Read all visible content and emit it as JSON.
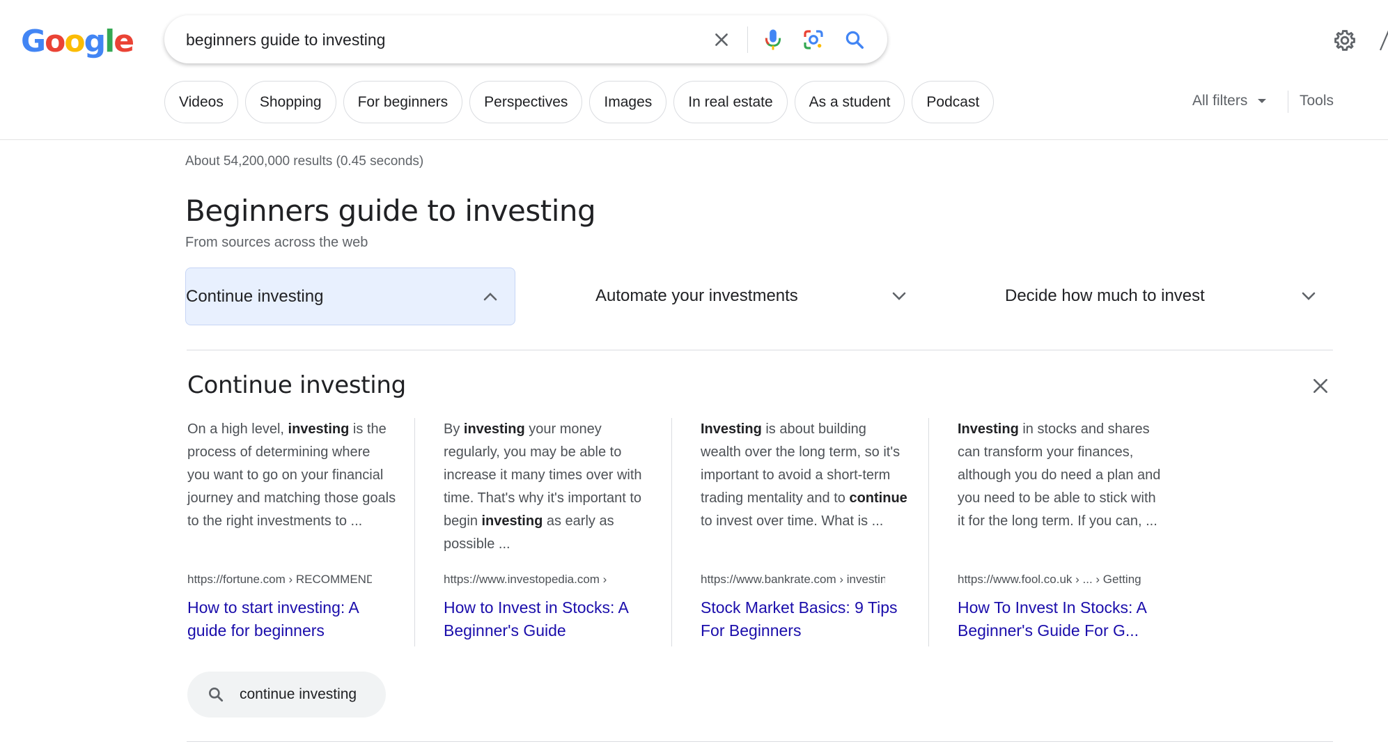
{
  "logo": {
    "letters": [
      {
        "ch": "G",
        "color": "#4285f4"
      },
      {
        "ch": "o",
        "color": "#ea4335"
      },
      {
        "ch": "o",
        "color": "#fbbc05"
      },
      {
        "ch": "g",
        "color": "#4285f4"
      },
      {
        "ch": "l",
        "color": "#34a853"
      },
      {
        "ch": "e",
        "color": "#ea4335"
      }
    ]
  },
  "search": {
    "value": "beginners guide to investing",
    "icons": [
      "clear-icon",
      "microphone-icon",
      "lens-icon",
      "search-icon"
    ]
  },
  "chips": [
    "Videos",
    "Shopping",
    "For beginners",
    "Perspectives",
    "Images",
    "In real estate",
    "As a student",
    "Podcast"
  ],
  "toolbar": {
    "all_filters": "All filters",
    "tools": "Tools"
  },
  "results": {
    "stats": "About 54,200,000 results (0.45 seconds)",
    "heading": "Beginners guide to investing",
    "subheading": "From sources across the web"
  },
  "accordion": [
    {
      "label": "Continue investing",
      "expanded": true
    },
    {
      "label": "Automate your investments",
      "expanded": false
    },
    {
      "label": "Decide how much to invest",
      "expanded": false
    }
  ],
  "panel": {
    "title": "Continue investing",
    "cards": [
      {
        "snippet": [
          {
            "t": "On a high level, ",
            "b": false
          },
          {
            "t": "investing",
            "b": true
          },
          {
            "t": " is the process of determining where you want to go on your financial journey and matching those goals to the right investments to ...",
            "b": false
          }
        ],
        "url": "https://fortune.com › RECOMMENDED",
        "title": "How to start investing: A guide for beginners"
      },
      {
        "snippet": [
          {
            "t": "By ",
            "b": false
          },
          {
            "t": "investing",
            "b": true
          },
          {
            "t": " your money regularly, you may be able to increase it many times over with time. That's why it's important to begin ",
            "b": false
          },
          {
            "t": "investing",
            "b": true
          },
          {
            "t": " as early as possible ...",
            "b": false
          }
        ],
        "url": "https://www.investopedia.com ›",
        "title": "How to Invest in Stocks: A Beginner's Guide"
      },
      {
        "snippet": [
          {
            "t": "Investing",
            "b": true
          },
          {
            "t": " is about building wealth over the long term, so it's important to avoid a short-term trading mentality and to ",
            "b": false
          },
          {
            "t": "continue",
            "b": true
          },
          {
            "t": " to invest over time. What is ...",
            "b": false
          }
        ],
        "url": "https://www.bankrate.com › investing",
        "title": "Stock Market Basics: 9 Tips For Beginners"
      },
      {
        "snippet": [
          {
            "t": "Investing",
            "b": true
          },
          {
            "t": " in stocks and shares can transform your finances, although you do need a plan and you need to be able to stick with it for the long term. If you can, ...",
            "b": false
          }
        ],
        "url": "https://www.fool.co.uk › ... › Getting",
        "title": "How To Invest In Stocks: A Beginner's Guide For G..."
      }
    ]
  },
  "related_search": {
    "label": "continue investing"
  }
}
